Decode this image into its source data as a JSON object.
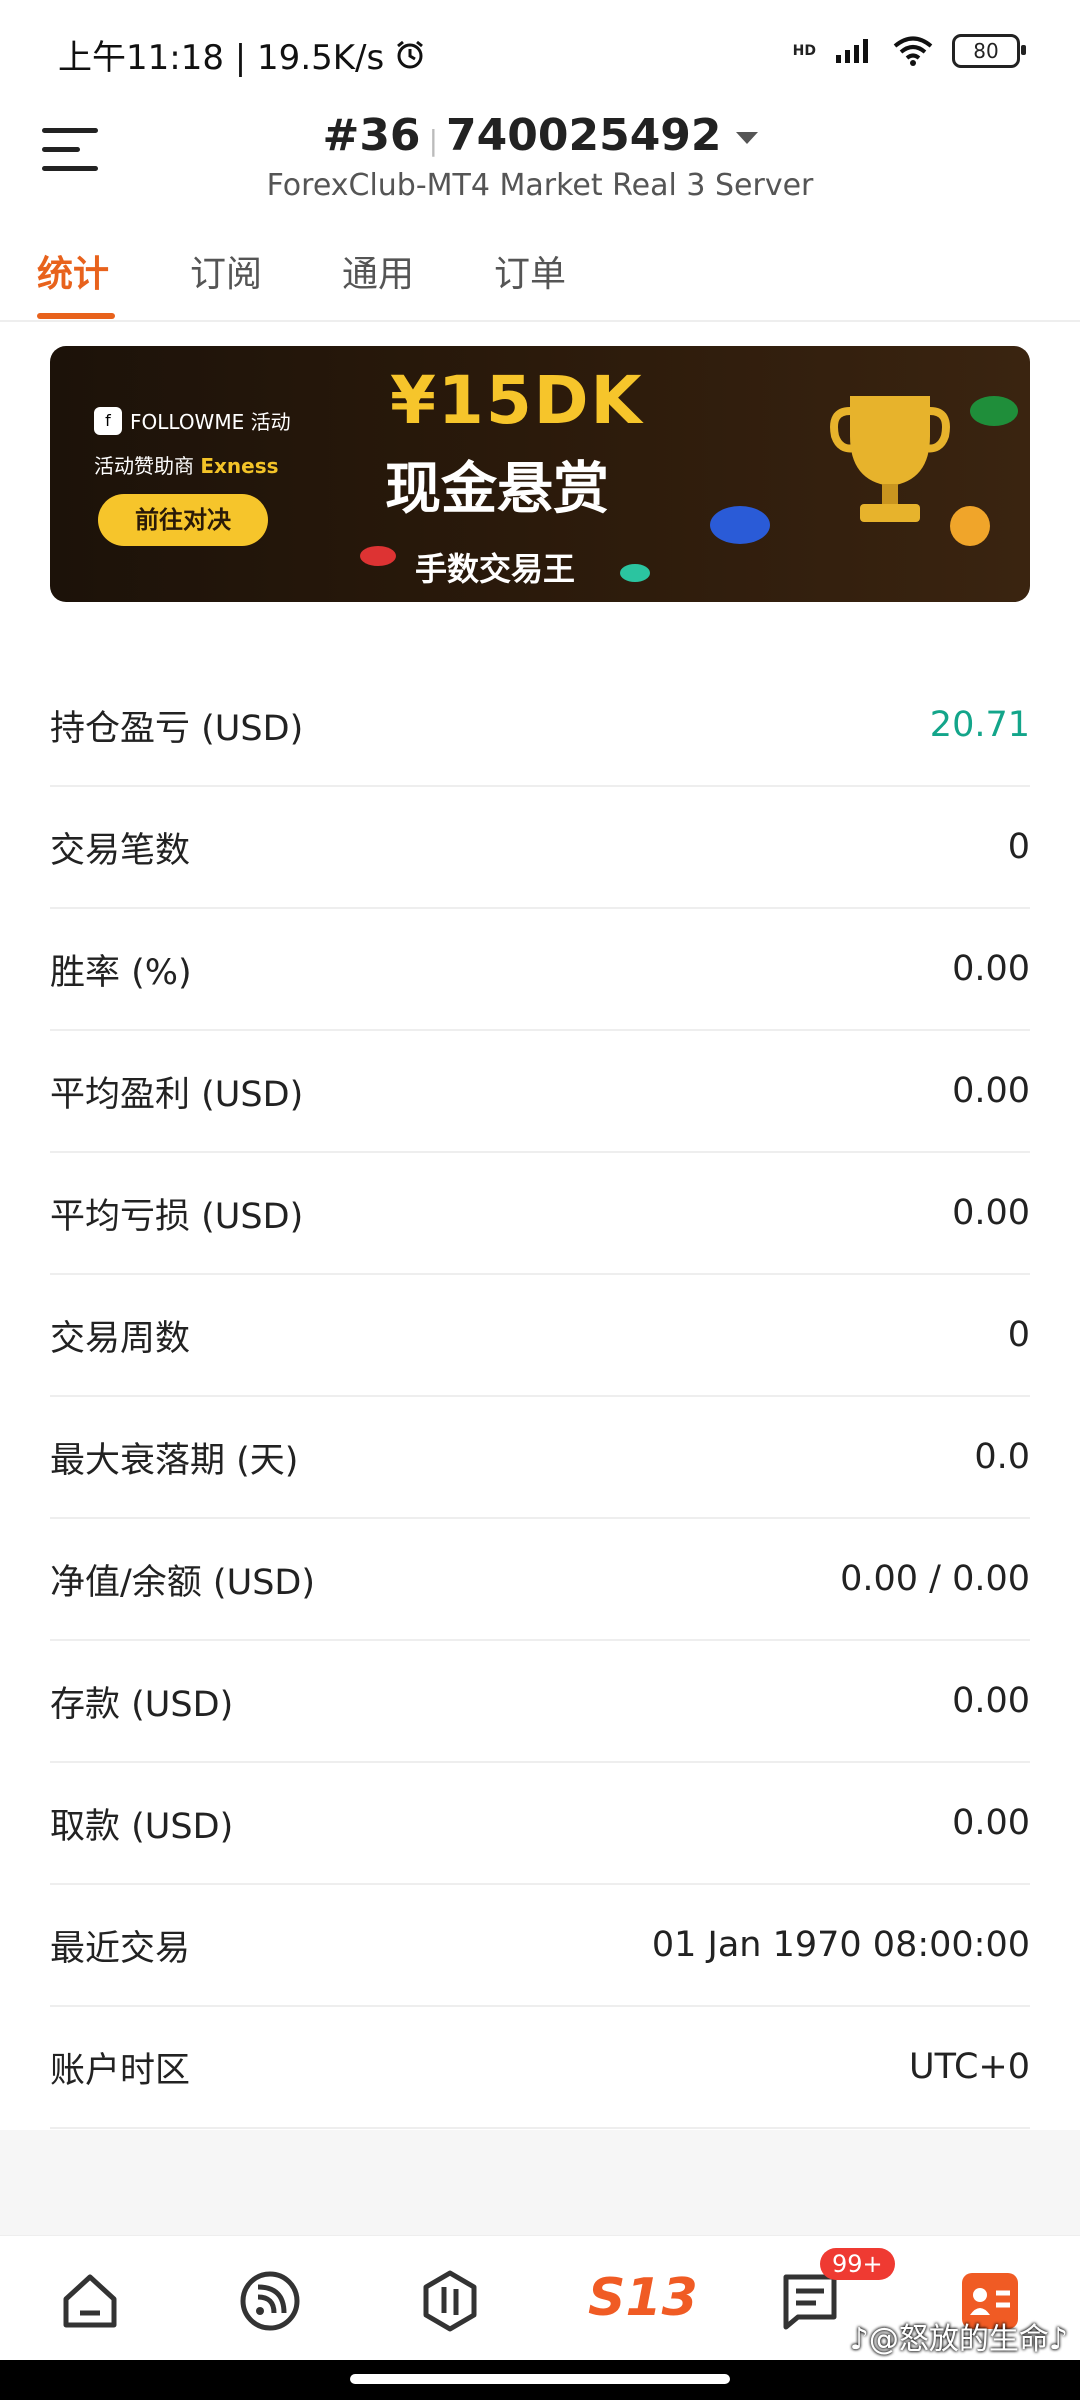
{
  "status_bar": {
    "time_speed": "上午11:18 | 19.5K/s",
    "network": "HD",
    "battery": "80"
  },
  "header": {
    "account_index": "#36",
    "account_number": "740025492",
    "server": "ForexClub-MT4 Market Real 3 Server"
  },
  "tabs": [
    {
      "label": "统计"
    },
    {
      "label": "订阅"
    },
    {
      "label": "通用"
    },
    {
      "label": "订单"
    }
  ],
  "banner": {
    "brand": "FOLLOWME 活动",
    "sponsor_prefix": "活动赞助商",
    "sponsor_name": "Exness",
    "cta": "前往对决",
    "headline": "¥15DK",
    "subheadline": "现金悬赏",
    "caption": "手数交易王"
  },
  "stats": [
    {
      "label": "持仓盈亏 (USD)",
      "value": "20.71"
    },
    {
      "label": "交易笔数",
      "value": "0"
    },
    {
      "label": "胜率 (%)",
      "value": "0.00"
    },
    {
      "label": "平均盈利 (USD)",
      "value": "0.00"
    },
    {
      "label": "平均亏损 (USD)",
      "value": "0.00"
    },
    {
      "label": "交易周数",
      "value": "0"
    },
    {
      "label": "最大衰落期 (天)",
      "value": "0.0"
    },
    {
      "label": "净值/余额 (USD)",
      "value": "0.00 / 0.00"
    },
    {
      "label": "存款 (USD)",
      "value": "0.00"
    },
    {
      "label": "取款 (USD)",
      "value": "0.00"
    },
    {
      "label": "最近交易",
      "value": "01 Jan 1970 08:00:00"
    },
    {
      "label": "账户时区",
      "value": "UTC+0"
    }
  ],
  "bottom_nav": {
    "logo": "S13",
    "badge": "99+",
    "watermark": "♪@怒放的生命♪"
  },
  "colors": {
    "accent": "#e8621c",
    "positive": "#13a58a",
    "badge": "#ef3a32"
  }
}
